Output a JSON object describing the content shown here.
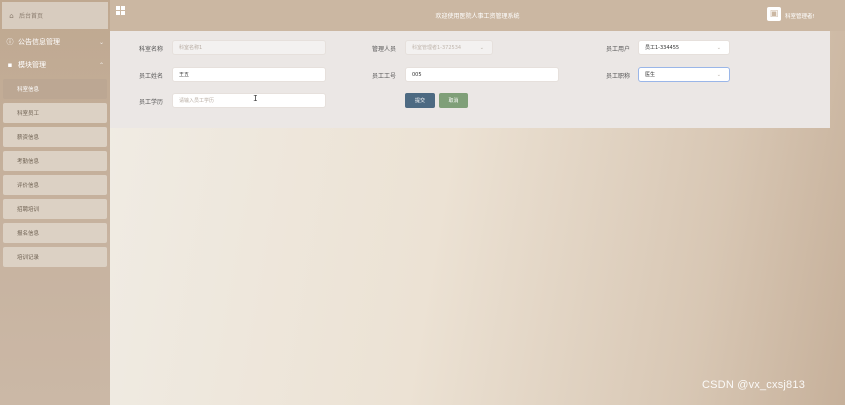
{
  "sidebar": {
    "home_label": "后台首页",
    "home_icon": "home-icon",
    "menus": [
      {
        "label": "公告信息管理",
        "icon": "info-circle-icon"
      },
      {
        "label": "模块管理",
        "icon": "grid-icon"
      }
    ],
    "items": [
      "科室信息",
      "科室员工",
      "薪资信息",
      "考勤信息",
      "评价信息",
      "招聘培训",
      "报名信息",
      "培训记录"
    ],
    "active_item": "科室信息"
  },
  "header": {
    "title": "欢迎使用医院人事工资管理系统",
    "user_label": "科室管理者!",
    "user_icon": "user-avatar-icon"
  },
  "form": {
    "dept_name": {
      "label": "科室名称",
      "placeholder": "科室名称1"
    },
    "manager": {
      "label": "管理人员",
      "value": "科室管理者1-372534"
    },
    "staff_account": {
      "label": "员工用户",
      "value": "员工1-334455"
    },
    "staff_name": {
      "label": "员工姓名",
      "value": "王五"
    },
    "staff_id": {
      "label": "员工工号",
      "value": "005"
    },
    "staff_title": {
      "label": "员工职称",
      "value": "医生"
    },
    "staff_edu": {
      "label": "员工学历",
      "placeholder": "请输入员工学历"
    },
    "submit_label": "提交",
    "cancel_label": "取消"
  },
  "watermark": "CSDN @vx_cxsj813",
  "colors": {
    "sidebar": "#bfa890",
    "header": "#cbb7a2",
    "submit": "#4d6a82",
    "cancel": "#7f9f78"
  }
}
